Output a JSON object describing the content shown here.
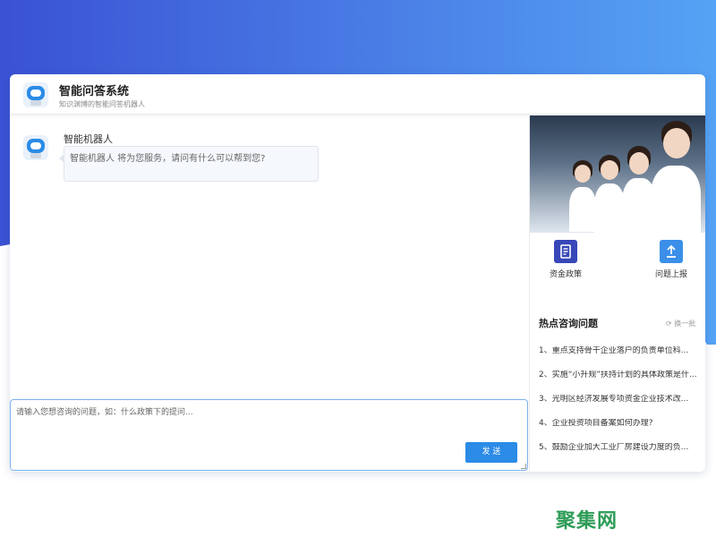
{
  "header": {
    "title": "智能问答系统",
    "subtitle": "知识渊博的智能问答机器人"
  },
  "chat": {
    "messages": [
      {
        "sender": "智能机器人",
        "text": "智能机器人 将为您服务，请问有什么可以帮到您?"
      }
    ]
  },
  "input": {
    "placeholder": "请输入您想咨询的问题，如：什么政策下的提问...",
    "send_label": "发 送"
  },
  "sidebar": {
    "quick_links": [
      {
        "label": "资金政策",
        "icon": "document-icon",
        "color": "#3847b8"
      },
      {
        "label": "问题上报",
        "icon": "upload-icon",
        "color": "#3b8fe8"
      }
    ],
    "hot_title": "热点咨询问题",
    "refresh_label": "换一批",
    "hot_questions": [
      "1、重点支持骨干企业落户的负责单位科...",
      "2、实施“小升规”扶持计划的具体政策是什...",
      "3、光明区经济发展专项资金企业技术改...",
      "4、企业投资项目备案如何办理?",
      "5、鼓励企业加大工业厂房建设力度的负..."
    ]
  },
  "watermark": "聚集网",
  "colors": {
    "accent": "#2b8be6",
    "gradient_start": "#3a52d4",
    "gradient_end": "#55a3f5"
  }
}
